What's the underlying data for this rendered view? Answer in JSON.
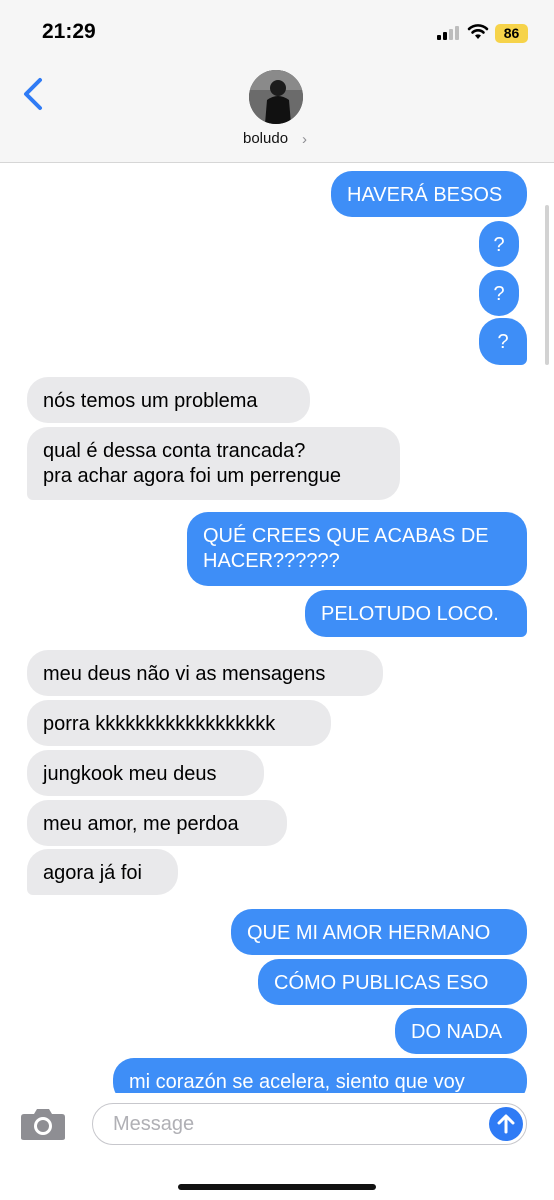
{
  "status_bar": {
    "time": "21:29",
    "battery": "86"
  },
  "header": {
    "contact_name": "boludo"
  },
  "messages": [
    {
      "dir": "out",
      "text": "HAVERÁ BESOS"
    },
    {
      "dir": "out",
      "text": "?"
    },
    {
      "dir": "out",
      "text": "?"
    },
    {
      "dir": "out",
      "text": "?"
    },
    {
      "dir": "in",
      "text": "nós temos um problema"
    },
    {
      "dir": "in",
      "text": "qual é dessa conta trancada?\npra achar agora foi um perrengue"
    },
    {
      "dir": "out",
      "text": "QUÉ CREES QUE ACABAS DE\nHACER??????"
    },
    {
      "dir": "out",
      "text": "PELOTUDO LOCO."
    },
    {
      "dir": "in",
      "text": "meu deus não vi as mensagens"
    },
    {
      "dir": "in",
      "text": "porra kkkkkkkkkkkkkkkkkk"
    },
    {
      "dir": "in",
      "text": "jungkook meu deus"
    },
    {
      "dir": "in",
      "text": "meu amor, me perdoa"
    },
    {
      "dir": "in",
      "text": "agora já foi"
    },
    {
      "dir": "out",
      "text": "QUE MI AMOR HERMANO"
    },
    {
      "dir": "out",
      "text": "CÓMO PUBLICAS ESO"
    },
    {
      "dir": "out",
      "text": "DO NADA"
    },
    {
      "dir": "out",
      "text": "mi corazón se acelera, siento que voy"
    }
  ],
  "input": {
    "placeholder": "Message"
  },
  "colors": {
    "outgoing": "#3e8ef7",
    "incoming": "#e9e9eb",
    "accent": "#2f7bf5"
  }
}
